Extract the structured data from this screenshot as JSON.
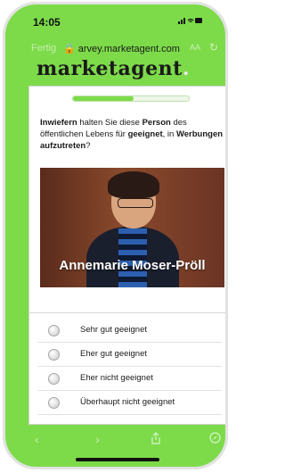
{
  "status_bar": {
    "time": "14:05",
    "indicators": "•••• ■"
  },
  "browser": {
    "done_label": "Fertig",
    "url": "🔒 arvey.marketagent.com",
    "text_size_label": "AA"
  },
  "brand": {
    "name": "marketagent",
    "dot": "."
  },
  "survey": {
    "progress_percent": 52,
    "question_parts": [
      {
        "text": "Inwiefern",
        "bold": true
      },
      {
        "text": " halten Sie diese ",
        "bold": false
      },
      {
        "text": "Person",
        "bold": true
      },
      {
        "text": " des öffentlichen Lebens für ",
        "bold": false
      },
      {
        "text": "geeignet",
        "bold": true
      },
      {
        "text": ", in ",
        "bold": false
      },
      {
        "text": "Werbungen aufzutreten",
        "bold": true
      },
      {
        "text": "?",
        "bold": false
      }
    ],
    "photo_caption": "Annemarie Moser-Pröll",
    "options": [
      {
        "label": "Sehr gut geeignet"
      },
      {
        "label": "Eher gut geeignet"
      },
      {
        "label": "Eher nicht geeignet"
      },
      {
        "label": "Überhaupt nicht geeignet"
      }
    ]
  },
  "icons": {
    "lock": "lock-icon",
    "reload": "reload-icon",
    "back": "back-icon",
    "forward": "forward-icon",
    "share": "share-icon",
    "compass": "compass-icon"
  },
  "colors": {
    "accent_green": "#7ddb4a"
  }
}
